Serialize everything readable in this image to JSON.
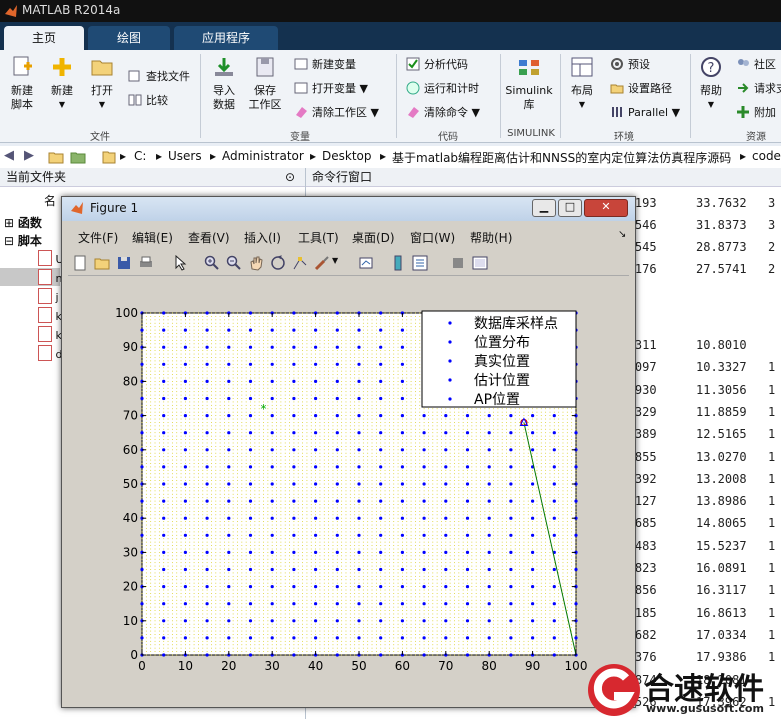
{
  "window": {
    "title": "MATLAB R2014a"
  },
  "tabs": [
    {
      "label": "主页"
    },
    {
      "label": "绘图"
    },
    {
      "label": "应用程序"
    }
  ],
  "ribbon": {
    "file": {
      "label": "文件",
      "new_script": "新建\n脚本",
      "new": "新建",
      "open": "打开",
      "find_files": "查找文件",
      "compare": "比较"
    },
    "variable": {
      "label": "变量",
      "import": "导入\n数据",
      "save_ws": "保存\n工作区",
      "new_var": "新建变量",
      "open_var": "打开变量",
      "clear_ws": "清除工作区"
    },
    "code": {
      "label": "代码",
      "analyze": "分析代码",
      "run_time": "运行和计时",
      "clear_cmd": "清除命令"
    },
    "simulink": {
      "label": "SIMULINK",
      "lib": "Simulink\n库"
    },
    "env": {
      "label": "环境",
      "layout": "布局",
      "prefs": "预设",
      "set_path": "设置路径",
      "parallel": "Parallel"
    },
    "resources": {
      "label": "资源",
      "help": "帮助",
      "community": "社区",
      "request": "请求支",
      "addons": "附加"
    }
  },
  "path": [
    "C:",
    "Users",
    "Administrator",
    "Desktop",
    "基于matlab编程距离估计和NNSS的室内定位算法仿真程序源码",
    "code"
  ],
  "left_panel": {
    "title": "当前文件夹",
    "col_name": "名",
    "tree": [
      {
        "label": "函数"
      },
      {
        "label": "脚本"
      }
    ],
    "file_initials": [
      "U",
      "n",
      "j",
      "k",
      "k",
      "d"
    ]
  },
  "command_window": {
    "title": "命令行窗口",
    "rows_top": [
      [
        "33.3193",
        "33.7632",
        "3"
      ],
      [
        "31.1546",
        "31.8373",
        "3"
      ],
      [
        "28.0545",
        "28.8773",
        "2"
      ],
      [
        "26.1176",
        "27.5741",
        "2"
      ]
    ],
    "rows_bottom": [
      [
        "11.1311",
        "10.8010",
        ""
      ],
      [
        "11.2097",
        "10.3327",
        "1"
      ],
      [
        "11.9930",
        "11.3056",
        "1"
      ],
      [
        "12.5329",
        "11.8859",
        "1"
      ],
      [
        "12.8389",
        "12.5165",
        "1"
      ],
      [
        "13.2855",
        "13.0270",
        "1"
      ],
      [
        "14.7392",
        "13.2008",
        "1"
      ],
      [
        "14.9127",
        "13.8986",
        "1"
      ],
      [
        "15.3685",
        "14.8065",
        "1"
      ],
      [
        "16.4483",
        "15.5237",
        "1"
      ],
      [
        "16.5823",
        "16.0891",
        "1"
      ],
      [
        "17.4856",
        "16.3117",
        "1"
      ],
      [
        "18.2185",
        "16.8613",
        "1"
      ],
      [
        "18.4682",
        "17.0334",
        "1"
      ],
      [
        "18.4376",
        "17.9386",
        "1"
      ],
      [
        "18.7874",
        "18.2081",
        ""
      ],
      [
        "19.2526",
        "17.3962",
        "1"
      ]
    ]
  },
  "figure": {
    "title": "Figure 1",
    "menu": [
      "文件(F)",
      "编辑(E)",
      "查看(V)",
      "插入(I)",
      "工具(T)",
      "桌面(D)",
      "窗口(W)",
      "帮助(H)"
    ]
  },
  "chart_data": {
    "type": "scatter",
    "title": "",
    "xlabel": "",
    "ylabel": "",
    "xlim": [
      0,
      100
    ],
    "ylim": [
      0,
      100
    ],
    "xticks": [
      0,
      10,
      20,
      30,
      40,
      50,
      60,
      70,
      80,
      90,
      100
    ],
    "yticks": [
      0,
      10,
      20,
      30,
      40,
      50,
      60,
      70,
      80,
      90,
      100
    ],
    "grid_step_blue": 5,
    "grid_step_yellow": 1,
    "legend": [
      "数据库采样点",
      "位置分布",
      "真实位置",
      "估计位置",
      "AP位置"
    ],
    "legend_position": "top-right",
    "series": [
      {
        "name": "数据库采样点",
        "color": "#0000ff",
        "marker": "dot",
        "grid": {
          "start": 0,
          "end": 100,
          "step": 5
        }
      },
      {
        "name": "位置分布",
        "color": "#d4c800",
        "marker": "point",
        "grid": {
          "start": 0,
          "end": 100,
          "step": 1
        }
      },
      {
        "name": "真实位置",
        "color": "#00aa00",
        "marker": "star",
        "points": [
          [
            28,
            72
          ]
        ]
      },
      {
        "name": "估计位置",
        "color": "#cc0000",
        "marker": "circle",
        "points": [
          [
            88,
            68
          ]
        ]
      },
      {
        "name": "AP位置",
        "color": "#0000ff",
        "marker": "triangle",
        "points": [
          [
            88,
            68
          ]
        ]
      }
    ],
    "lines": [
      {
        "color": "#007700",
        "from": [
          88,
          68
        ],
        "to": [
          100,
          0
        ]
      }
    ]
  },
  "colors": {
    "tabbar": "#14314f",
    "accent": "#0000ff"
  },
  "watermark": {
    "brand": "合速软件",
    "url": "www.gususoft.com"
  }
}
